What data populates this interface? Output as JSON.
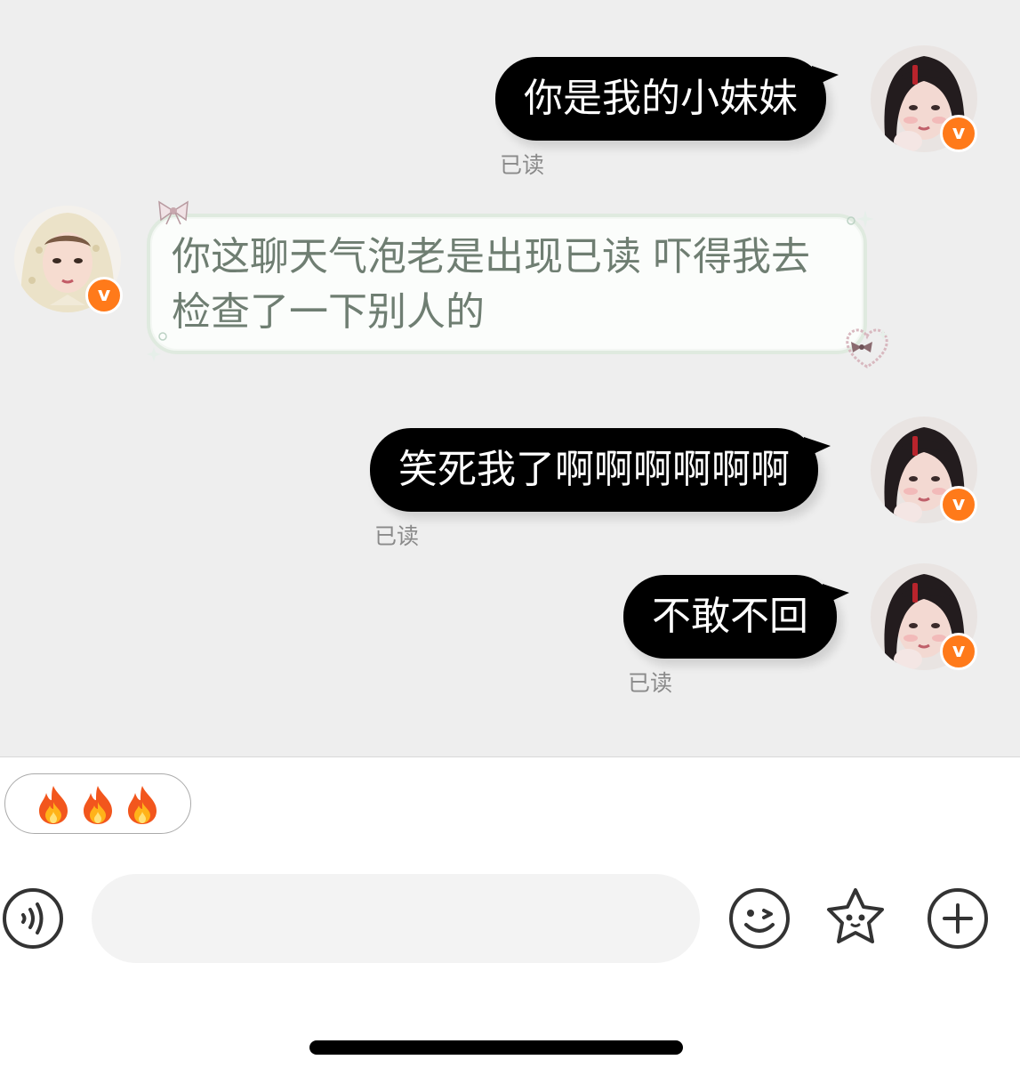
{
  "messages": [
    {
      "side": "right",
      "text": "你是我的小妹妹",
      "status": "已读"
    },
    {
      "side": "left",
      "text": "你这聊天气泡老是出现已读 吓得我去检查了一下别人的"
    },
    {
      "side": "right",
      "text": "笑死我了啊啊啊啊啊啊",
      "status": "已读"
    },
    {
      "side": "right",
      "text": "不敢不回",
      "status": "已读"
    }
  ],
  "badge": {
    "label": "v",
    "color": "#ff7a1a"
  },
  "quick_reply": {
    "emoji": [
      "fire",
      "fire",
      "fire"
    ]
  },
  "composer": {
    "input_value": "",
    "voice_icon": "voice-waves-icon",
    "emoji_icon": "winking-face-icon",
    "sticker_icon": "star-face-icon",
    "plus_icon": "plus-circle-icon"
  },
  "colors": {
    "chat_background": "#eeeeee",
    "outgoing_bubble": "#000000",
    "incoming_bubble_border": "#dfeadf",
    "incoming_text": "#6f7e72",
    "read_label": "#8a8a8a"
  }
}
